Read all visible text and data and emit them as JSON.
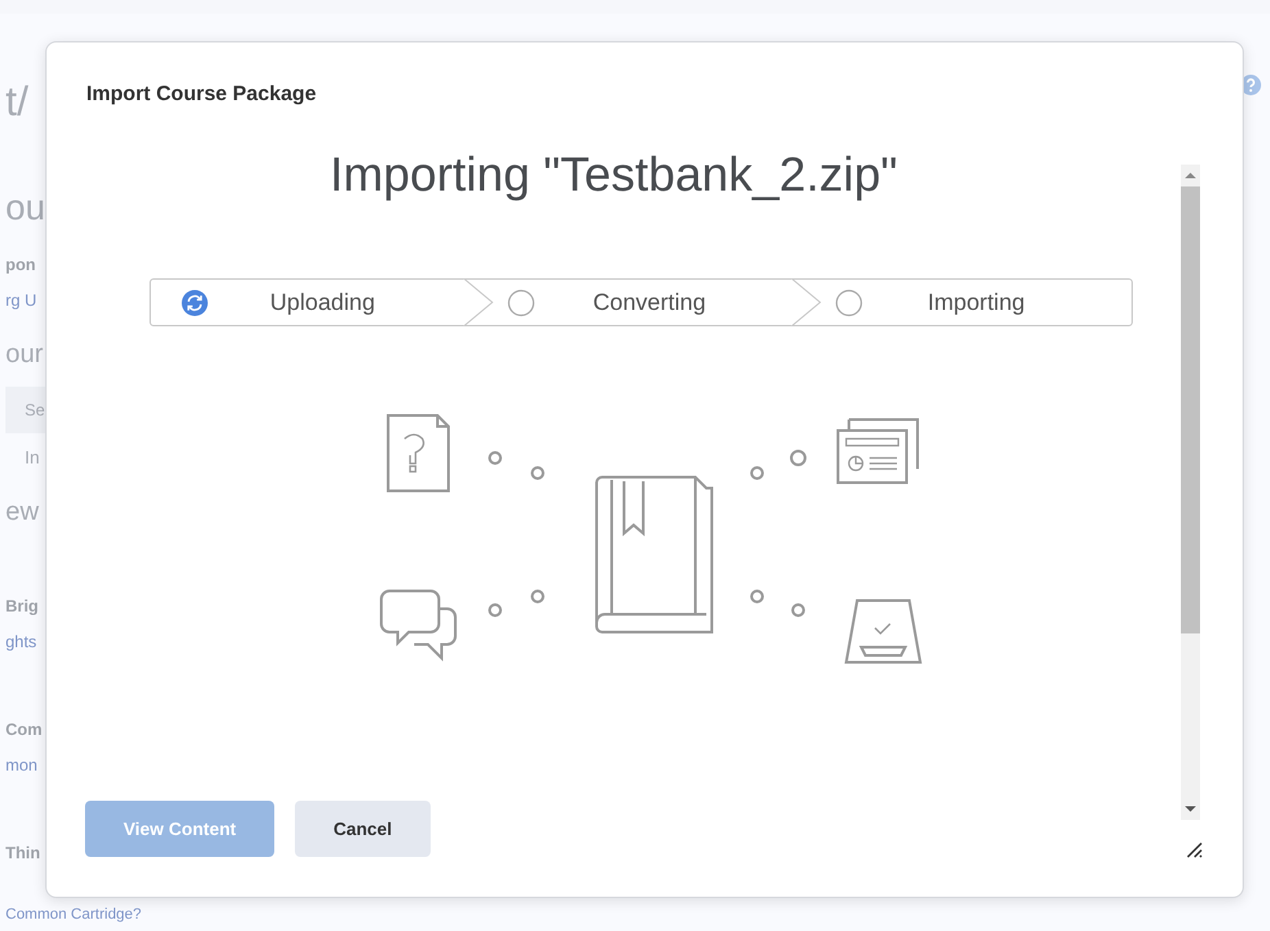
{
  "background": {
    "fragments": [
      {
        "text": "t/",
        "kind": "heading"
      },
      {
        "text": "ou",
        "kind": "heading"
      },
      {
        "text": "pon",
        "kind": "bold"
      },
      {
        "text": "rg U",
        "kind": "link"
      },
      {
        "text": "our",
        "kind": "subheading"
      },
      {
        "text": "Se",
        "kind": "band"
      },
      {
        "text": "In",
        "kind": "iconitem"
      },
      {
        "text": "ew",
        "kind": "subheading"
      },
      {
        "text": "Brig",
        "kind": "bold"
      },
      {
        "text": "ghts",
        "kind": "link"
      },
      {
        "text": "Com",
        "kind": "bold"
      },
      {
        "text": "mon",
        "kind": "link"
      },
      {
        "text": "Thin",
        "kind": "bold"
      },
      {
        "text": "Common Cartridge?",
        "kind": "link"
      }
    ]
  },
  "dialog": {
    "title": "Import Course Package",
    "heading": "Importing \"Testbank_2.zip\"",
    "steps": [
      {
        "label": "Uploading",
        "active": true
      },
      {
        "label": "Converting",
        "active": false
      },
      {
        "label": "Importing",
        "active": false
      }
    ],
    "buttons": [
      {
        "label": "View Content",
        "kind": "primary",
        "disabled": true
      },
      {
        "label": "Cancel",
        "kind": "secondary",
        "disabled": false
      }
    ]
  }
}
